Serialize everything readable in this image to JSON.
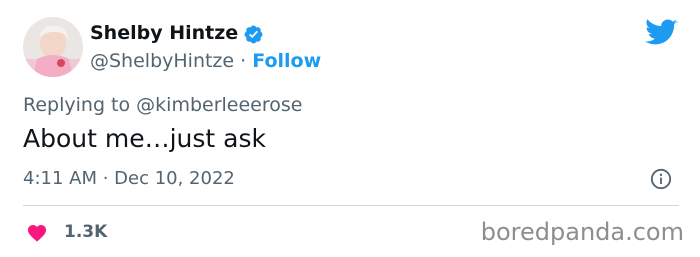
{
  "author": {
    "display_name": "Shelby Hintze",
    "handle": "@ShelbyHintze",
    "separator": "·",
    "follow_label": "Follow",
    "verified_icon": "verified-badge-icon",
    "avatar_icon": "profile-photo"
  },
  "brand": {
    "logo_icon": "twitter-bird-icon",
    "accent_color": "#1d9bf0"
  },
  "tweet": {
    "replying_to": "Replying to @kimberleeerose",
    "text": "About me…just ask",
    "timestamp": "4:11 AM · Dec 10, 2022",
    "info_icon": "info-icon"
  },
  "engagement": {
    "like_icon": "heart-icon",
    "like_color": "#f91880",
    "like_count": "1.3K"
  },
  "watermark": "boredpanda.com"
}
